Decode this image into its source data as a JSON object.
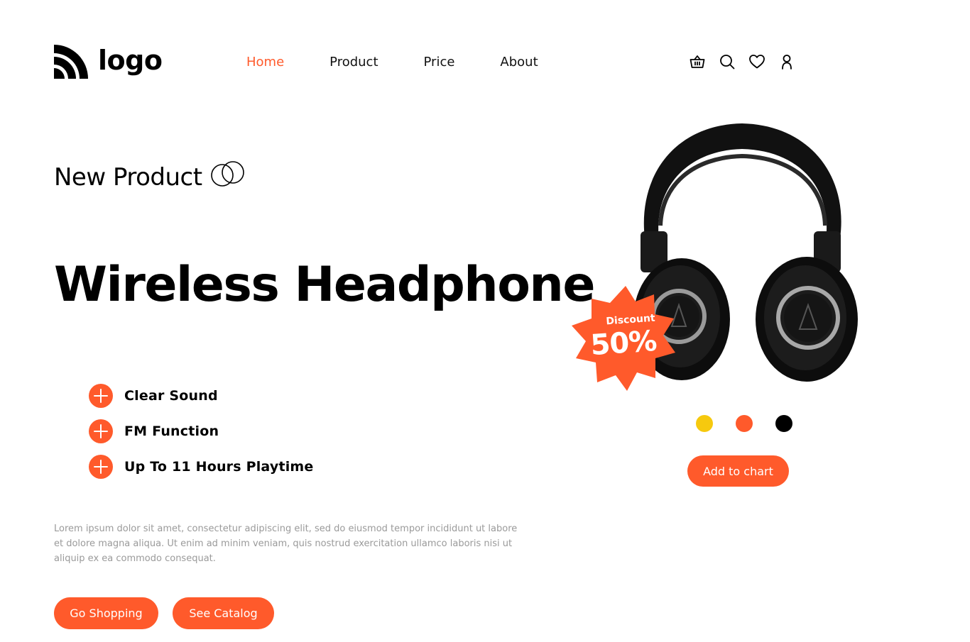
{
  "header": {
    "logo_text": "logo",
    "nav": [
      {
        "label": "Home",
        "active": true
      },
      {
        "label": "Product",
        "active": false
      },
      {
        "label": "Price",
        "active": false
      },
      {
        "label": "About",
        "active": false
      }
    ],
    "icons": [
      "basket-icon",
      "search-icon",
      "heart-icon",
      "user-icon"
    ]
  },
  "hero": {
    "eyebrow": "New Product",
    "title": "Wireless Headphone",
    "features": [
      "Clear Sound",
      "FM Function",
      "Up To 11 Hours Playtime"
    ],
    "description": "Lorem ipsum dolor sit amet, consectetur adipiscing elit, sed do eiusmod tempor incididunt ut labore et dolore magna aliqua. Ut enim ad minim veniam, quis nostrud exercitation ullamco laboris nisi ut aliquip ex ea commodo consequat.",
    "buttons": {
      "go_shopping": "Go Shopping",
      "see_catalog": "See Catalog"
    }
  },
  "product": {
    "badge": {
      "label": "Discount",
      "value": "50%"
    },
    "color_options": [
      "#F6C90E",
      "#FF5A2B",
      "#000000"
    ],
    "add_to_cart": "Add to chart"
  },
  "colors": {
    "accent": "#FF5A2B",
    "text": "#000000",
    "muted": "#9A9A9A"
  }
}
